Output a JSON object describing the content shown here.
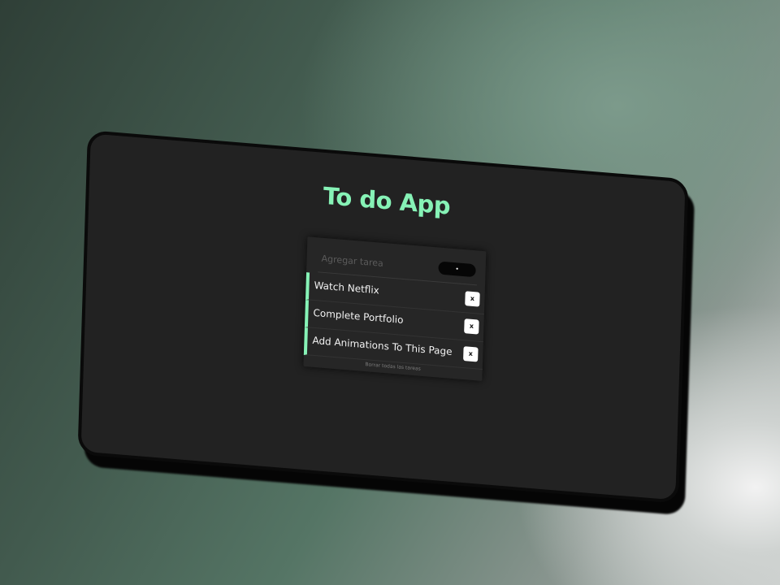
{
  "app": {
    "title": "To do App"
  },
  "add_form": {
    "input_placeholder": "Agregar tarea",
    "input_value": "",
    "add_button_label": "•"
  },
  "tasks": [
    {
      "label": "Watch Netflix",
      "delete_label": "x"
    },
    {
      "label": "Complete Portfolio",
      "delete_label": "x"
    },
    {
      "label": "Add Animations To This Page",
      "delete_label": "x"
    }
  ],
  "footer": {
    "clear_all_label": "Borrar todas las tareas"
  },
  "colors": {
    "accent": "#86f2b6",
    "screen_background": "#222222",
    "card_background": "#262626"
  }
}
